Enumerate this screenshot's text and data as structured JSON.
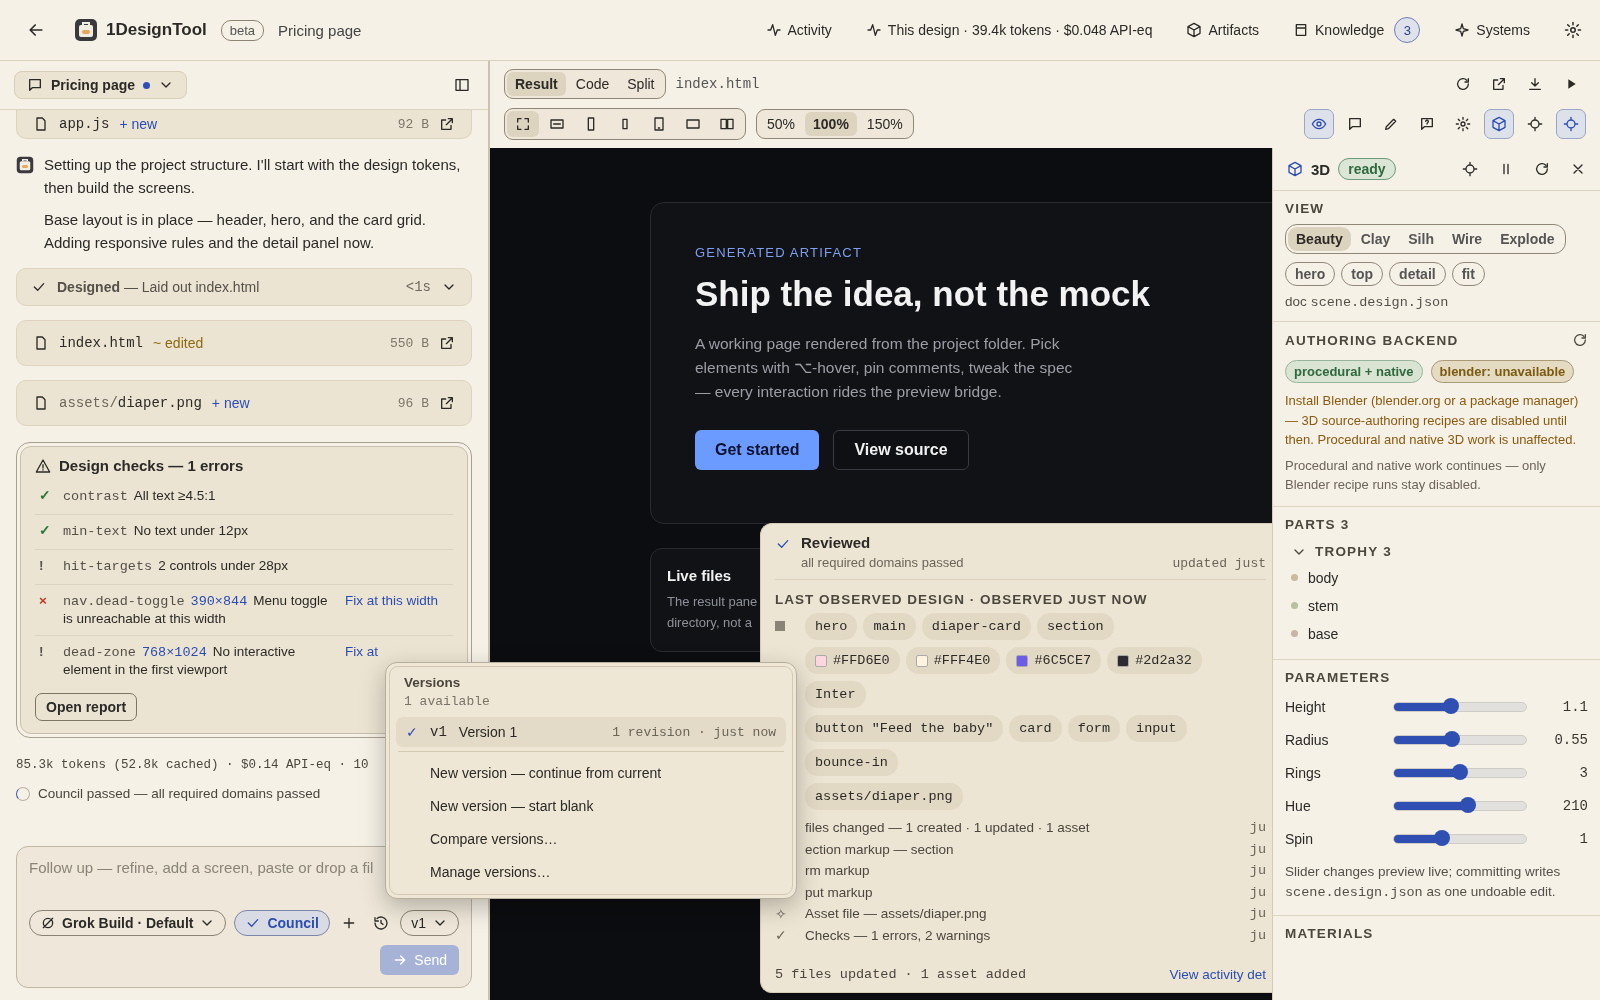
{
  "header": {
    "app": "1DesignTool",
    "badge": "beta",
    "page": "Pricing page",
    "nav": [
      {
        "label": "Activity"
      },
      {
        "label": "This design · 39.4k tokens · $0.048 API-eq"
      },
      {
        "label": "Artifacts"
      },
      {
        "label": "Knowledge",
        "count": "3"
      },
      {
        "label": "Systems"
      }
    ]
  },
  "session": {
    "label": "Pricing page",
    "unsaved": true
  },
  "feed": [
    {
      "kind": "file",
      "name": "app.js",
      "tag": "+ new",
      "color": "#2b4db3",
      "size": "92 B"
    },
    {
      "kind": "message",
      "paragraphs": [
        "Setting up the project structure. I'll start with the design tokens, then build the screens.",
        "Base layout is in place — header, hero, and the card grid. Adding responsive rules and the detail panel now."
      ]
    },
    {
      "kind": "step",
      "title": "Designed",
      "detail": "— Laid out index.html",
      "time": "<1s"
    },
    {
      "kind": "file",
      "name": "index.html",
      "tag": "~ edited",
      "color": "#8b6a10",
      "size": "550 B"
    },
    {
      "kind": "file",
      "dir": "assets/",
      "name": "diaper.png",
      "tag": "+ new",
      "color": "#2b4db3",
      "size": "96 B"
    }
  ],
  "checks": {
    "title": "Design checks — 1 errors",
    "items": [
      {
        "color": "#2c7a3b",
        "mark": "✓",
        "rule": "contrast",
        "text": "All text ≥4.5:1"
      },
      {
        "color": "#2c7a3b",
        "mark": "✓",
        "rule": "min-text",
        "text": "No text under 12px"
      },
      {
        "color": "#555555",
        "mark": "!",
        "rule": "hit-targets",
        "text": "2 controls under 28px"
      },
      {
        "color": "#c0392b",
        "mark": "×",
        "rule": "nav.dead-toggle",
        "size": "390×844",
        "text": "Menu toggle is unreachable at this width",
        "fix": "Fix at this width"
      },
      {
        "color": "#555555",
        "mark": "!",
        "rule": "dead-zone",
        "size": "768×1024",
        "text": "No interactive element in the first viewport",
        "fix": "Fix at"
      }
    ],
    "button": "Open report"
  },
  "usage": "85.3k tokens (52.8k cached) · $0.14 API-eq · 10",
  "council_status": "Council passed — all required domains passed",
  "composer": {
    "placeholder": "Follow up — refine, add a screen, paste or drop a fil",
    "model": "Grok Build · Default",
    "council": {
      "label": "Council",
      "on": true
    },
    "version": "v1",
    "send": "Send",
    "send_disabled": true
  },
  "toolbar": {
    "modes": [
      {
        "label": "Result",
        "selected": true
      },
      {
        "label": "Code",
        "selected": false
      },
      {
        "label": "Split",
        "selected": false
      }
    ],
    "file": "index.html",
    "viewports": [
      {
        "selected": true
      },
      {
        "selected": false
      },
      {
        "selected": false
      },
      {
        "selected": false
      },
      {
        "selected": false
      },
      {
        "selected": false
      },
      {
        "selected": false
      }
    ],
    "zooms": [
      {
        "label": "50%",
        "selected": false
      },
      {
        "label": "100%",
        "selected": true
      },
      {
        "label": "150%",
        "selected": false
      }
    ],
    "tools": [
      {
        "selected": true
      },
      {
        "selected": false
      },
      {
        "selected": false
      },
      {
        "selected": false
      },
      {
        "selected": false
      },
      {
        "selected": true
      },
      {
        "selected": false
      },
      {
        "selected": true
      }
    ]
  },
  "preview": {
    "eyebrow": "GENERATED ARTIFACT",
    "title": "Ship the idea, not the mock",
    "body": "A working page rendered from the project folder. Pick elements with ⌥-hover, pin comments, tweak the spec — every interaction rides the preview bridge.",
    "primary": "Get started",
    "secondary": "View source",
    "live": {
      "title": "Live files",
      "lines": [
        "The result pane",
        "directory, not a"
      ]
    }
  },
  "reviewed": {
    "title": "Reviewed",
    "subtitle": "all required domains passed",
    "updated": "updated just",
    "heading": "LAST OBSERVED DESIGN · OBSERVED JUST NOW",
    "token_rows": [
      {
        "chips": [
          {
            "label": "hero"
          },
          {
            "label": "main"
          },
          {
            "label": "diaper-card"
          },
          {
            "label": "section"
          }
        ]
      },
      {
        "chips": [
          {
            "label": "#FFD6E0",
            "color": "#ffd6e0"
          },
          {
            "label": "#FFF4E0",
            "color": "#fff4e0"
          },
          {
            "label": "#6C5CE7",
            "color": "#6c5ce7"
          },
          {
            "label": "#2d2a32",
            "color": "#2d2a32"
          }
        ]
      },
      {
        "chips": [
          {
            "label": "Inter"
          }
        ]
      },
      {
        "chips": [
          {
            "label": "button \"Feed the baby\""
          },
          {
            "label": "card"
          },
          {
            "label": "form"
          },
          {
            "label": "input"
          }
        ]
      },
      {
        "chips": [
          {
            "label": "bounce-in"
          }
        ]
      },
      {
        "chips": [
          {
            "label": "assets/diaper.png"
          }
        ]
      }
    ],
    "activity": [
      {
        "text": "files changed — 1 created · 1 updated · 1 asset",
        "time": "ju"
      },
      {
        "text": "ection markup — section",
        "time": "ju"
      },
      {
        "text": "rm markup",
        "time": "ju"
      },
      {
        "text": "put markup",
        "time": "ju"
      },
      {
        "mark": "✧",
        "text": "Asset file — assets/diaper.png",
        "time": "ju"
      },
      {
        "mark": "✓",
        "text": "Checks — 1 errors, 2 warnings",
        "time": "ju"
      }
    ],
    "footer": "5 files updated · 1 asset added",
    "link": "View activity det"
  },
  "versions": {
    "title": "Versions",
    "subtitle": "1 available",
    "items": [
      {
        "mark": "✓",
        "id": "v1",
        "name": "Version 1",
        "meta": "1 revision · just now",
        "selected": true
      }
    ],
    "actions": [
      "New version — continue from current",
      "New version — start blank",
      "Compare versions…",
      "Manage versions…"
    ]
  },
  "panel": {
    "title": "3D",
    "status": "ready",
    "view": {
      "heading": "VIEW",
      "modes": [
        {
          "label": "Beauty",
          "selected": true
        },
        {
          "label": "Clay",
          "selected": false
        },
        {
          "label": "Silh",
          "selected": false
        },
        {
          "label": "Wire",
          "selected": false
        },
        {
          "label": "Explode",
          "selected": false
        }
      ],
      "cameras": [
        "hero",
        "top",
        "detail",
        "fit"
      ],
      "doc_label": "doc",
      "doc": "scene.design.json"
    },
    "backend": {
      "heading": "AUTHORING BACKEND",
      "badges": [
        {
          "label": "procedural + native",
          "kind": "ok"
        },
        {
          "label": "blender: unavailable",
          "kind": "warn"
        }
      ],
      "warning": "Install Blender (blender.org or a package manager) — 3D source-authoring recipes are disabled until then. Procedural and native 3D work is unaffected.",
      "note": "Procedural and native work continues — only Blender recipe runs stay disabled."
    },
    "parts": {
      "heading": "PARTS",
      "count": "3",
      "groups": [
        {
          "label": "TROPHY",
          "count": "3",
          "expanded": true,
          "children": [
            {
              "label": "body",
              "color": "#c9bc9e"
            },
            {
              "label": "stem",
              "color": "#b9c09e"
            },
            {
              "label": "base",
              "color": "#c6b6a6"
            }
          ]
        }
      ]
    },
    "parameters": {
      "heading": "PARAMETERS",
      "items": [
        {
          "label": "Height",
          "level": 0.43,
          "reading": "1.1"
        },
        {
          "label": "Radius",
          "level": 0.44,
          "reading": "0.55"
        },
        {
          "label": "Rings",
          "level": 0.5,
          "reading": "3"
        },
        {
          "label": "Hue",
          "level": 0.56,
          "reading": "210"
        },
        {
          "label": "Spin",
          "level": 0.36,
          "reading": "1"
        }
      ],
      "note_before": "Slider changes preview live; committing writes",
      "note_code": "scene.design.json",
      "note_after": "as one undoable edit."
    },
    "materials": "MATERIALS"
  }
}
